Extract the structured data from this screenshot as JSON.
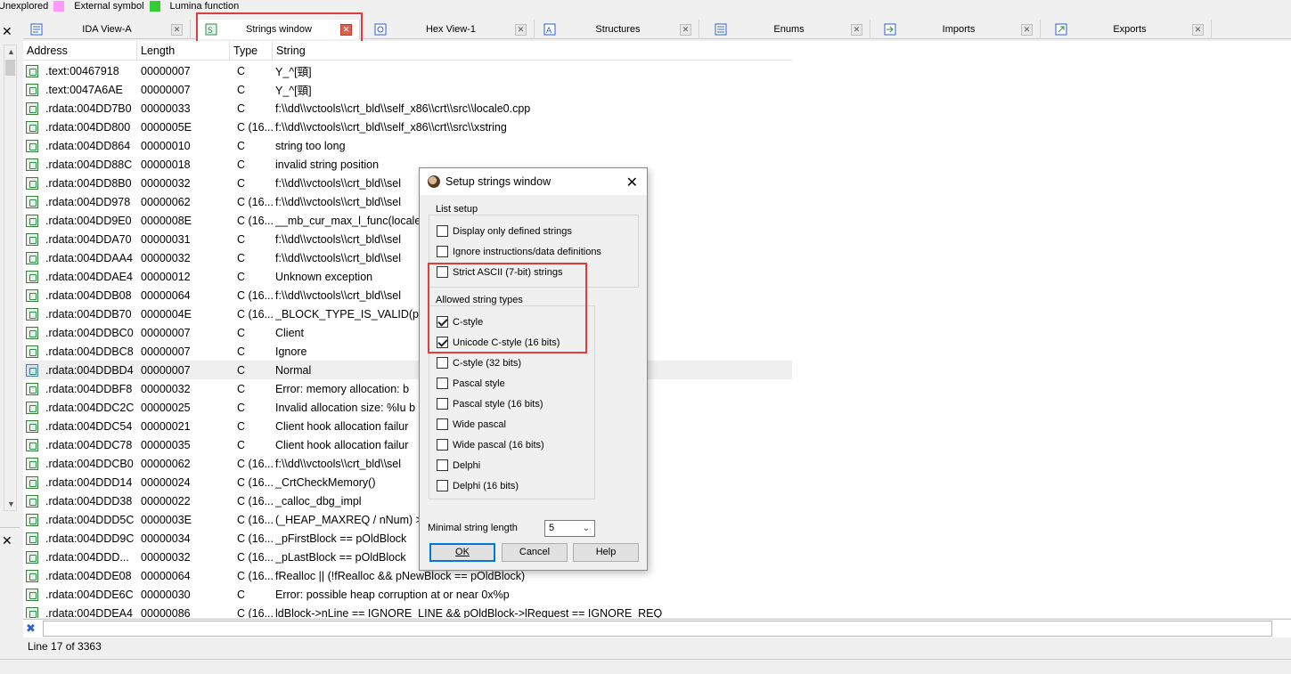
{
  "legend": [
    {
      "label": "Unexplored",
      "color": "#ffffff"
    },
    {
      "label": "External symbol",
      "color": "#ff99ff"
    },
    {
      "label": "Lumina function",
      "color": "#33cc33"
    }
  ],
  "tabs": [
    {
      "label": "IDA View-A",
      "icon": "disassembly-icon"
    },
    {
      "label": "Strings window",
      "icon": "strings-icon",
      "active": true
    },
    {
      "label": "Hex View-1",
      "icon": "hex-icon"
    },
    {
      "label": "Structures",
      "icon": "structures-icon"
    },
    {
      "label": "Enums",
      "icon": "enums-icon"
    },
    {
      "label": "Imports",
      "icon": "imports-icon"
    },
    {
      "label": "Exports",
      "icon": "exports-icon"
    }
  ],
  "list": {
    "columns": [
      "Address",
      "Length",
      "Type",
      "String"
    ],
    "rows": [
      [
        ".text:00467918",
        "00000007",
        "C",
        "Y_^[頸]"
      ],
      [
        ".text:0047A6AE",
        "00000007",
        "C",
        "Y_^[頸]"
      ],
      [
        ".rdata:004DD7B0",
        "00000033",
        "C",
        "f:\\\\dd\\\\vctools\\\\crt_bld\\\\self_x86\\\\crt\\\\src\\\\locale0.cpp"
      ],
      [
        ".rdata:004DD800",
        "0000005E",
        "C (16...",
        "f:\\\\dd\\\\vctools\\\\crt_bld\\\\self_x86\\\\crt\\\\src\\\\xstring"
      ],
      [
        ".rdata:004DD864",
        "00000010",
        "C",
        "string too long"
      ],
      [
        ".rdata:004DD88C",
        "00000018",
        "C",
        "invalid string position"
      ],
      [
        ".rdata:004DD8B0",
        "00000032",
        "C",
        "f:\\\\dd\\\\vctools\\\\crt_bld\\\\sel"
      ],
      [
        ".rdata:004DD978",
        "00000062",
        "C (16...",
        "f:\\\\dd\\\\vctools\\\\crt_bld\\\\sel"
      ],
      [
        ".rdata:004DD9E0",
        "0000008E",
        "C (16...",
        "__mb_cur_max_l_func(locale"
      ],
      [
        ".rdata:004DDA70",
        "00000031",
        "C",
        "f:\\\\dd\\\\vctools\\\\crt_bld\\\\sel"
      ],
      [
        ".rdata:004DDAA4",
        "00000032",
        "C",
        "f:\\\\dd\\\\vctools\\\\crt_bld\\\\sel"
      ],
      [
        ".rdata:004DDAE4",
        "00000012",
        "C",
        "Unknown exception"
      ],
      [
        ".rdata:004DDB08",
        "00000064",
        "C (16...",
        "f:\\\\dd\\\\vctools\\\\crt_bld\\\\sel"
      ],
      [
        ".rdata:004DDB70",
        "0000004E",
        "C (16...",
        "_BLOCK_TYPE_IS_VALID(pHe"
      ],
      [
        ".rdata:004DDBC0",
        "00000007",
        "C",
        "Client"
      ],
      [
        ".rdata:004DDBC8",
        "00000007",
        "C",
        "Ignore"
      ],
      [
        ".rdata:004DDBD4",
        "00000007",
        "C",
        "Normal"
      ],
      [
        ".rdata:004DDBF8",
        "00000032",
        "C",
        "Error: memory allocation: b"
      ],
      [
        ".rdata:004DDC2C",
        "00000025",
        "C",
        "Invalid allocation size: %Iu b"
      ],
      [
        ".rdata:004DDC54",
        "00000021",
        "C",
        "Client hook allocation failur"
      ],
      [
        ".rdata:004DDC78",
        "00000035",
        "C",
        "Client hook allocation failur"
      ],
      [
        ".rdata:004DDCB0",
        "00000062",
        "C (16...",
        "f:\\\\dd\\\\vctools\\\\crt_bld\\\\sel"
      ],
      [
        ".rdata:004DDD14",
        "00000024",
        "C (16...",
        "_CrtCheckMemory()"
      ],
      [
        ".rdata:004DDD38",
        "00000022",
        "C (16...",
        "_calloc_dbg_impl"
      ],
      [
        ".rdata:004DDD5C",
        "0000003E",
        "C (16...",
        "(_HEAP_MAXREQ / nNum) >"
      ],
      [
        ".rdata:004DDD9C",
        "00000034",
        "C (16...",
        "_pFirstBlock == pOldBlock"
      ],
      [
        ".rdata:004DDD...",
        "00000032",
        "C (16...",
        "_pLastBlock == pOldBlock"
      ],
      [
        ".rdata:004DDE08",
        "00000064",
        "C (16...",
        "fRealloc || (!fRealloc && pNewBlock == pOldBlock)"
      ],
      [
        ".rdata:004DDE6C",
        "00000030",
        "C",
        "Error: possible heap corruption at or near 0x%p"
      ],
      [
        ".rdata:004DDEA4",
        "00000086",
        "C (16...",
        "ldBlock->nLine == IGNORE_LINE && pOldBlock->lRequest == IGNORE_REQ"
      ]
    ],
    "selected_index": 16
  },
  "status": "Line 17 of 3363",
  "dialog": {
    "title": "Setup strings window",
    "list_setup_label": "List setup",
    "list_setup": [
      {
        "label": "Display only defined strings",
        "checked": false
      },
      {
        "label": "Ignore instructions/data definitions",
        "checked": false
      },
      {
        "label": "Strict ASCII (7-bit) strings",
        "checked": false
      }
    ],
    "types_label": "Allowed string types",
    "types": [
      {
        "label": "C-style",
        "checked": true
      },
      {
        "label": "Unicode C-style (16 bits)",
        "checked": true
      },
      {
        "label": "C-style (32 bits)",
        "checked": false
      },
      {
        "label": "Pascal style",
        "checked": false
      },
      {
        "label": "Pascal style (16 bits)",
        "checked": false
      },
      {
        "label": "Wide pascal",
        "checked": false
      },
      {
        "label": "Wide pascal (16 bits)",
        "checked": false
      },
      {
        "label": "Delphi",
        "checked": false
      },
      {
        "label": "Delphi (16 bits)",
        "checked": false
      }
    ],
    "min_len_label": "Minimal string length",
    "min_len_value": "5",
    "buttons": {
      "ok": "OK",
      "cancel": "Cancel",
      "help": "Help"
    }
  }
}
